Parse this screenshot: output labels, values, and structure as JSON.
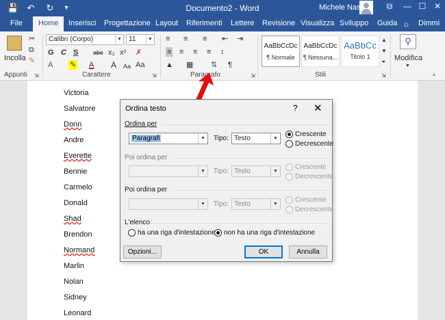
{
  "titlebar": {
    "save_icon": "💾",
    "undo_icon": "↶",
    "redo_icon": "↻",
    "customize_icon": "▾",
    "document_title": "Documento2 - Word",
    "user": "Michele Nasi",
    "ribbon_display_icon": "⧉",
    "minimize": "—",
    "maximize": "☐",
    "close": "✕"
  },
  "tabs": [
    "File",
    "Home",
    "Inserisci",
    "Progettazione",
    "Layout",
    "Riferimenti",
    "Lettere",
    "Revisione",
    "Visualizza",
    "Sviluppo",
    "Guida",
    "Dimmi"
  ],
  "ribbon": {
    "paste_label": "Incolla",
    "clipboard_label": "Appunti",
    "font_group_label": "Carattere",
    "paragraph_group_label": "Paragrafo",
    "styles_group_label": "Stili",
    "editing_label": "Modifica",
    "font_name": "Calibri (Corpo)",
    "font_size": "11",
    "font_buttons": [
      "G",
      "C",
      "S",
      "abc",
      "x₂",
      "x²"
    ],
    "font_row3": [
      "A",
      "A",
      "A",
      "Aa"
    ],
    "styles": [
      {
        "preview": "AaBbCcDc",
        "name": "¶ Normale"
      },
      {
        "preview": "AaBbCcDc",
        "name": "¶ Nessuna..."
      },
      {
        "preview": "AaBbCc",
        "name": "Titolo 1"
      }
    ]
  },
  "names": [
    "Victoria",
    "Salvatore",
    "Donn",
    "Andre",
    "Everette",
    "Bennie",
    "Carmelo",
    "Donald",
    "Shad",
    "Brendon",
    "Normand",
    "Marlin",
    "Nolan",
    "Sidney",
    "Leonard"
  ],
  "dialog": {
    "title": "Ordina testo",
    "help": "?",
    "close": "✕",
    "sort_by": {
      "label": "Ordina per",
      "field": "Paragrafi",
      "type_label": "Tipo:",
      "type": "Testo",
      "ascending": "Crescente",
      "descending": "Decrescente"
    },
    "then_by_1": {
      "label": "Poi ordina per",
      "type_label": "Tipo:",
      "type": "Testo",
      "ascending": "Crescente",
      "descending": "Decrescente"
    },
    "then_by_2": {
      "label": "Poi ordina per",
      "type_label": "Tipo:",
      "type": "Testo",
      "ascending": "Crescente",
      "descending": "Decrescente"
    },
    "list_label": "L'elenco",
    "header_yes": "ha una riga d'intestazione",
    "header_no": "non ha una riga d'intestazione",
    "options_button": "Opzioni...",
    "ok_button": "OK",
    "cancel_button": "Annulla"
  }
}
